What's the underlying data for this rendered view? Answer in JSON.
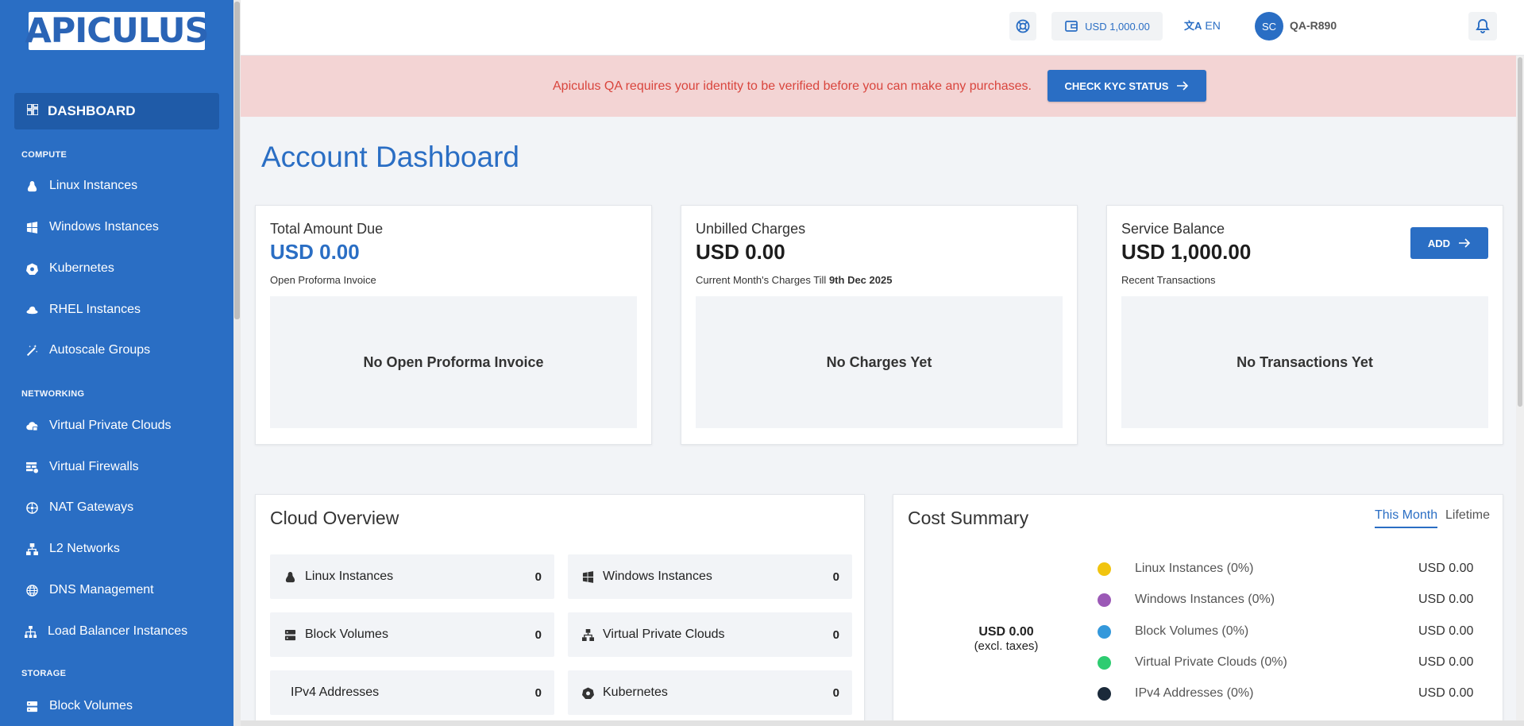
{
  "app": {
    "logo_text": "APICULUS"
  },
  "sidebar": {
    "active": {
      "label": "DASHBOARD"
    },
    "sections": {
      "compute": "COMPUTE",
      "networking": "NETWORKING",
      "storage": "STORAGE"
    },
    "items": [
      {
        "label": "Linux Instances",
        "icon": "linux-icon"
      },
      {
        "label": "Windows Instances",
        "icon": "windows-icon"
      },
      {
        "label": "Kubernetes",
        "icon": "kubernetes-icon"
      },
      {
        "label": "RHEL Instances",
        "icon": "redhat-icon"
      },
      {
        "label": "Autoscale Groups",
        "icon": "magic-wand-icon"
      },
      {
        "label": "Virtual Private Clouds",
        "icon": "cloud-lock-icon"
      },
      {
        "label": "Virtual Firewalls",
        "icon": "firewall-icon"
      },
      {
        "label": "NAT Gateways",
        "icon": "gateway-icon"
      },
      {
        "label": "L2 Networks",
        "icon": "network-icon"
      },
      {
        "label": "DNS Management",
        "icon": "globe-icon"
      },
      {
        "label": "Load Balancer Instances",
        "icon": "load-balancer-icon"
      },
      {
        "label": "Block Volumes",
        "icon": "storage-icon"
      }
    ]
  },
  "topbar": {
    "wallet": "USD 1,000.00",
    "language": "EN",
    "avatar_initials": "SC",
    "username": "QA-R890"
  },
  "kyc": {
    "message": "Apiculus QA requires your identity to be verified before you can make any purchases.",
    "button": "CHECK KYC STATUS"
  },
  "page": {
    "title": "Account Dashboard"
  },
  "cards": {
    "due": {
      "label": "Total Amount Due",
      "amount": "USD 0.00",
      "sub": "Open Proforma Invoice",
      "empty": "No Open Proforma Invoice"
    },
    "unbilled": {
      "label": "Unbilled Charges",
      "amount": "USD 0.00",
      "sub_prefix": "Current Month's Charges Till",
      "sub_date": "9th Dec 2025",
      "empty": "No Charges Yet"
    },
    "balance": {
      "label": "Service Balance",
      "amount": "USD 1,000.00",
      "sub": "Recent Transactions",
      "empty": "No Transactions Yet",
      "add_button": "ADD"
    }
  },
  "overview": {
    "title": "Cloud Overview",
    "tiles": [
      {
        "label": "Linux Instances",
        "count": "0"
      },
      {
        "label": "Windows Instances",
        "count": "0"
      },
      {
        "label": "Block Volumes",
        "count": "0"
      },
      {
        "label": "Virtual Private Clouds",
        "count": "0"
      },
      {
        "label": "IPv4 Addresses",
        "count": "0"
      },
      {
        "label": "Kubernetes",
        "count": "0"
      }
    ]
  },
  "cost": {
    "title": "Cost Summary",
    "tab_month": "This Month",
    "tab_lifetime": "Lifetime",
    "total": "USD 0.00",
    "total_note": "(excl. taxes)",
    "legend": [
      {
        "label": "Linux Instances (0%)",
        "amount": "USD 0.00",
        "color": "#f1c40f"
      },
      {
        "label": "Windows Instances (0%)",
        "amount": "USD 0.00",
        "color": "#9b59b6"
      },
      {
        "label": "Block Volumes (0%)",
        "amount": "USD 0.00",
        "color": "#3498db"
      },
      {
        "label": "Virtual Private Clouds (0%)",
        "amount": "USD 0.00",
        "color": "#2ecc71"
      },
      {
        "label": "IPv4 Addresses (0%)",
        "amount": "USD 0.00",
        "color": "#1b2a3a"
      }
    ]
  }
}
